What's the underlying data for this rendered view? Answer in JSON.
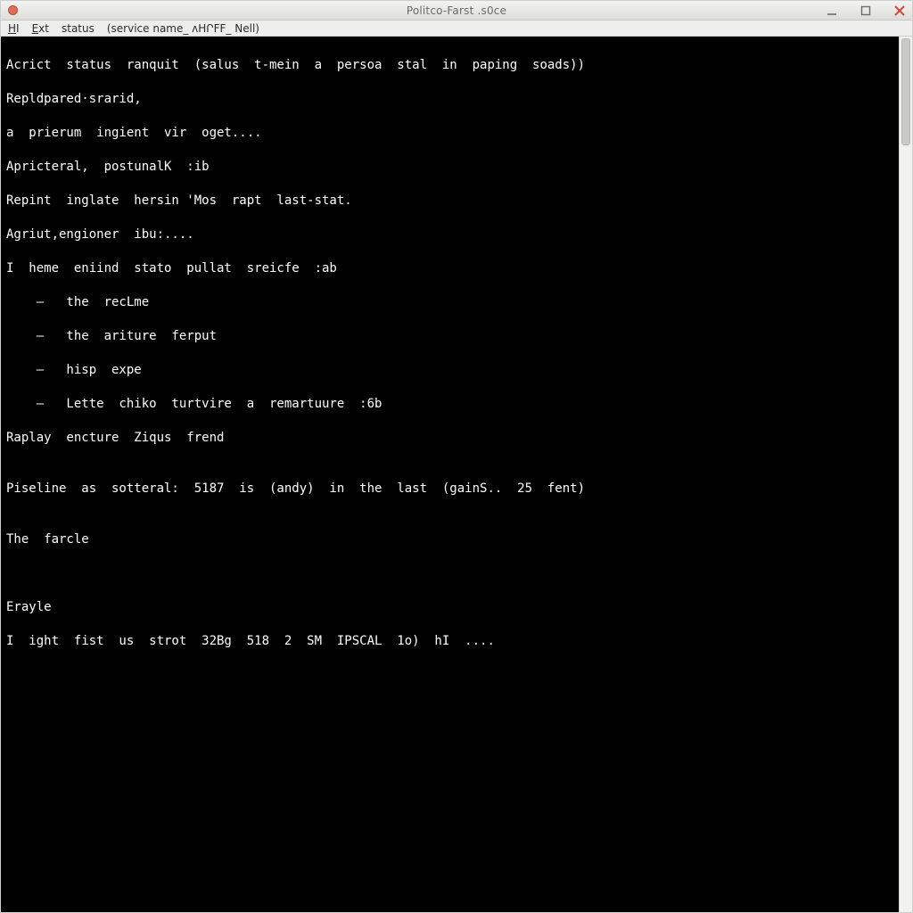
{
  "window": {
    "title": "Politco-Farst .s0ce"
  },
  "menubar": {
    "items": [
      "HI",
      "Ext",
      "status"
    ],
    "paren_text": "(service  name_  ᴧHՐFF_  Nell)"
  },
  "terminal": {
    "lines": [
      "Acrict  status  ranquit  (salus  t-mein  a  persoa  stal  in  paping  soads))",
      "Repldpared·srarid,",
      "a  prierum  ingient  vir  oget....",
      "Apricteral,  postunalK  :ib",
      "Repint  inglate  hersin 'Mos  rapt  last-stat.",
      "Agriut,engioner  ibu:....",
      "I  heme  eniind  stato  pullat  sreicfe  :ab",
      "    —   the  recLme",
      "    —   the  ariture  ferput",
      "    —   hisp  expe",
      "    —   Lette  chiko  turtvire  a  remartuure  :6b",
      "Raplay  encture  Ziqus  frend",
      "",
      "Piseline  as  sotteral:  5187  is  (andy)  in  the  last  (gainS..  25  fent)",
      "",
      "The  farcle",
      "",
      "",
      "Erayle",
      "I  ight  fist  us  strot  32Bg  518  2  SM  IPSCAL  1o)  hI  ...."
    ]
  },
  "colors": {
    "titlebar_text": "#6a6a6a",
    "terminal_bg": "#000000",
    "terminal_fg": "#ffffff",
    "close_icon": "#d24a3a"
  }
}
